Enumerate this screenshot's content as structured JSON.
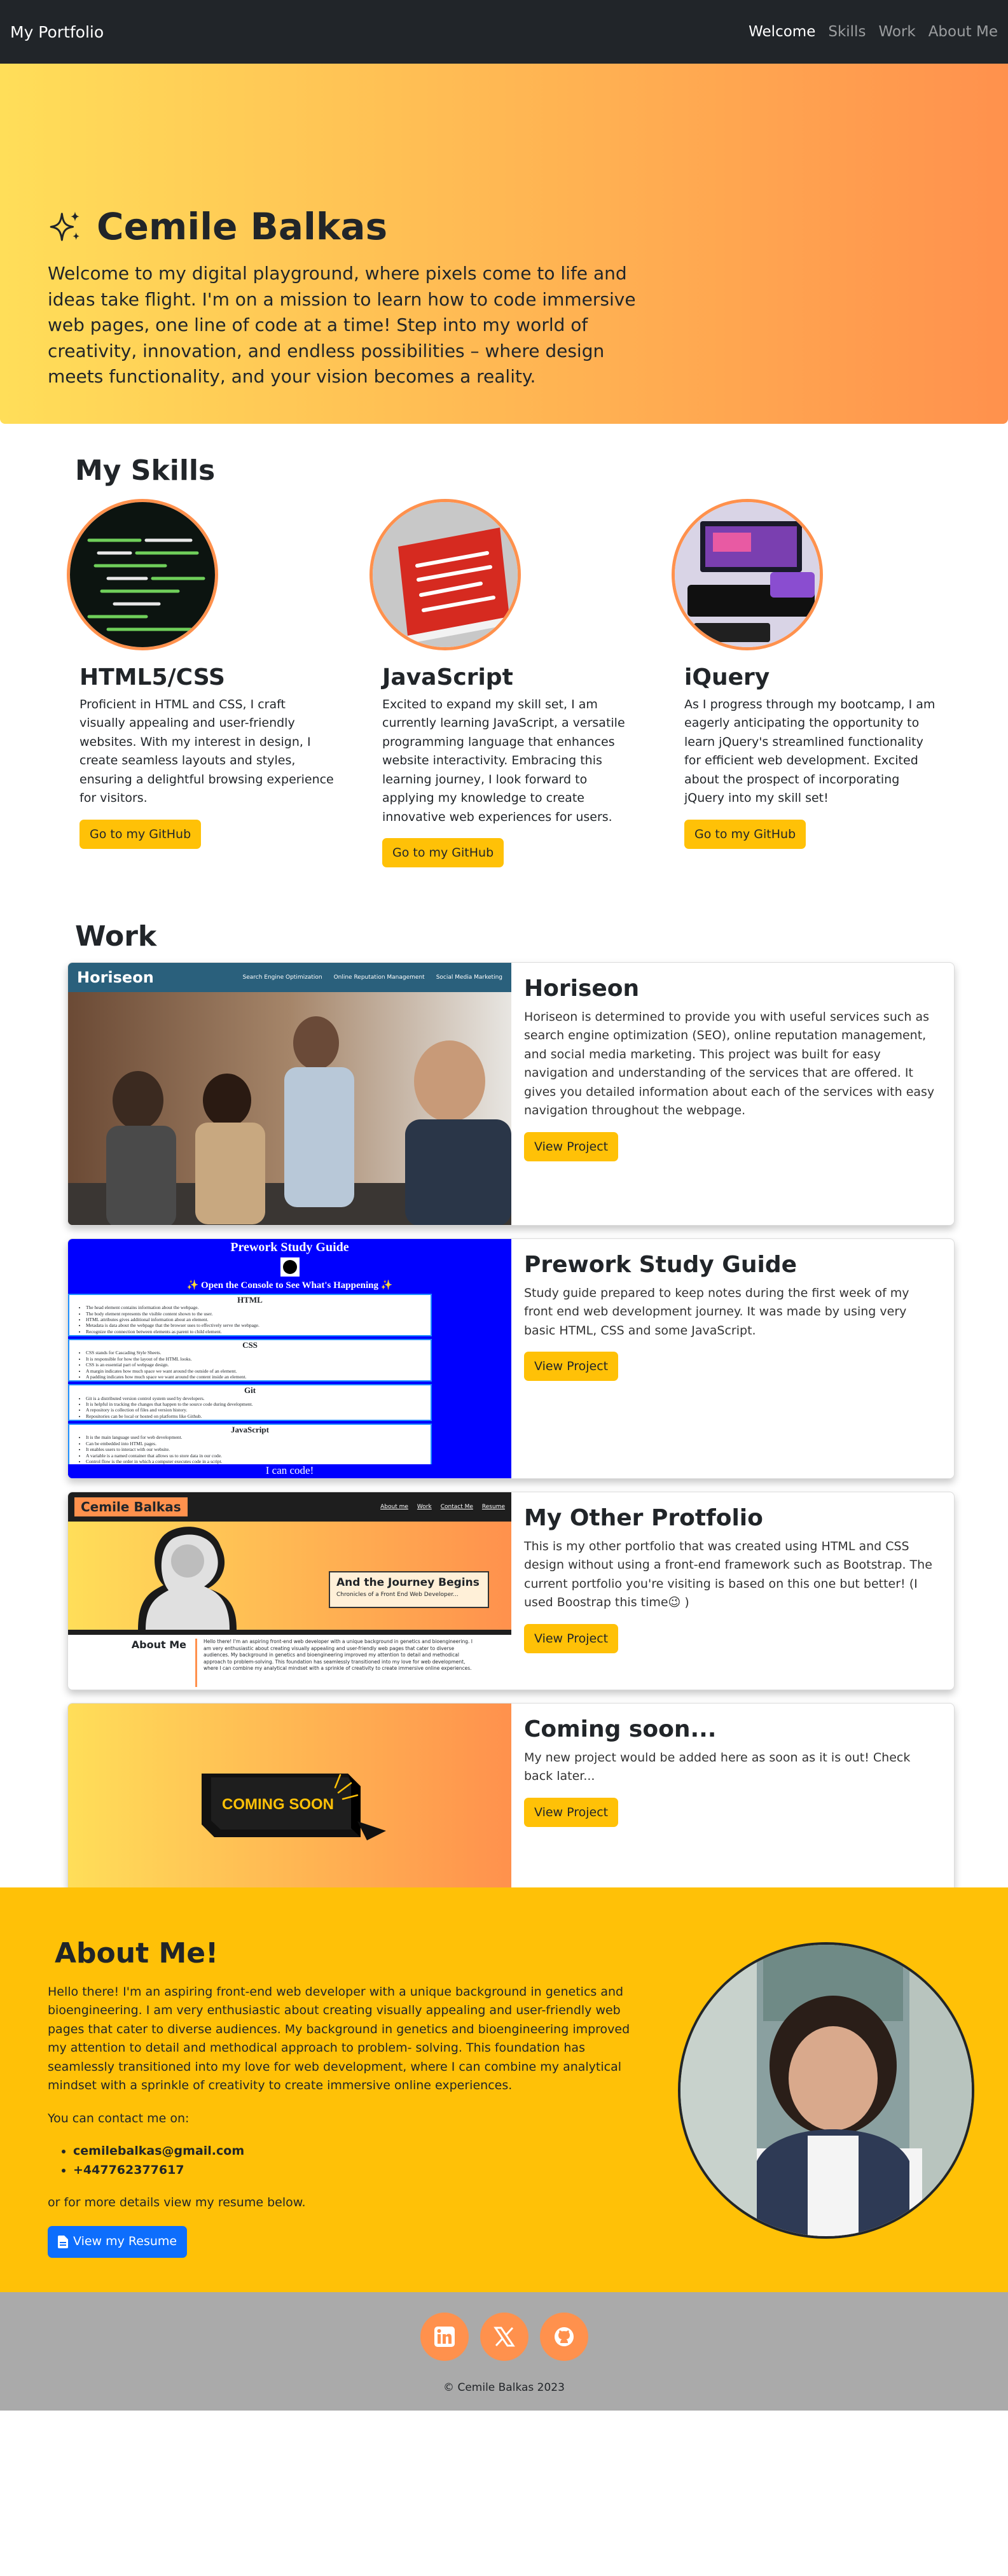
{
  "nav": {
    "brand": "My Portfolio",
    "links": [
      "Welcome",
      "Skills",
      "Work",
      "About Me"
    ]
  },
  "hero": {
    "name": "Cemile Balkas",
    "text": "Welcome to my digital playground, where pixels come to life and ideas take flight. I'm on a mission to learn how to code immersive web pages, one line of code at a time! Step into my world of creativity, innovation, and endless possibilities – where design meets functionality, and your vision becomes a reality."
  },
  "skills": {
    "title": "My Skills",
    "items": [
      {
        "title": "HTML5/CSS",
        "text": "Proficient in HTML and CSS, I craft visually appealing and user-friendly websites. With my interest in design, I create seamless layouts and styles, ensuring a delightful browsing experience for visitors.",
        "button": "Go to my GitHub"
      },
      {
        "title": "JavaScript",
        "text": "Excited to expand my skill set, I am currently learning JavaScript, a versatile programming language that enhances website interactivity. Embracing this learning journey, I look forward to applying my knowledge to create innovative web experiences for users.",
        "button": "Go to my GitHub"
      },
      {
        "title": "iQuery",
        "text": "As I progress through my bootcamp, I am eagerly anticipating the opportunity to learn jQuery's streamlined functionality for efficient web development. Excited about the prospect of incorporating jQuery into my skill set!",
        "button": "Go to my GitHub"
      }
    ]
  },
  "work": {
    "title": "Work",
    "projects": [
      {
        "title": "Horiseon",
        "text": "Horiseon is determined to provide you with useful services such as search engine optimization (SEO), online reputation management, and social media marketing. This project was built for easy navigation and understanding of the services that are offered. It gives you detailed information about each of the services with easy navigation throughout the webpage.",
        "button": "View Project",
        "preview": {
          "brand": "Horiseon",
          "nav": [
            "Search Engine Optimization",
            "Online Reputation Management",
            "Social Media Marketing"
          ]
        }
      },
      {
        "title": "Prework Study Guide",
        "text": "Study guide prepared to keep notes during the first week of my front end web development journey. It was made by using very basic HTML, CSS and some JavaScript.",
        "button": "View Project",
        "preview": {
          "heading": "Prework Study Guide",
          "console": "✨ Open the Console to See What's Happening ✨",
          "sections": [
            {
              "name": "HTML",
              "lines": [
                "The head element contains information about the webpage.",
                "The body element represents the visible content shown to the user.",
                "HTML attributes gives additional information about an element.",
                "Metadata is data about the webpage that the browser uses to effectively serve the webpage.",
                "Recognize the connection between elements as parent to child element."
              ]
            },
            {
              "name": "CSS",
              "lines": [
                "CSS stands for Cascading Style Sheets.",
                "It is responsible for how the layout of the HTML looks.",
                "CSS is an essential part of webpage design.",
                "A margin indicates how much space we want around the outside of an element.",
                "A padding indicates how much space we want around the content inside an element."
              ]
            },
            {
              "name": "Git",
              "lines": [
                "Git is a distributed version control system used by developers.",
                "It is helpful in tracking the changes that happen to the source code during development.",
                "A repository is collection of files and version history.",
                "Repositories can be local or hosted on platforms like Github."
              ]
            },
            {
              "name": "JavaScript",
              "lines": [
                "It is the main language used for web development.",
                "Can be embedded into HTML pages.",
                "It enables users to interact with our website.",
                "A variable is a named container that allows us to store data in our code.",
                "Control flow is the order in which a computer executes code in a script."
              ]
            }
          ],
          "footer": "I can code!"
        }
      },
      {
        "title": "My Other Protfolio",
        "text": "This is my other portfolio that was created using HTML and CSS design without using a front-end framework such as Bootstrap. The current portfolio you're visiting is based on this one but better! (I used Boostrap this time😉 )",
        "button": "View Project",
        "preview": {
          "brand": "Cemile Balkas",
          "nav": [
            "About me",
            "Work",
            "Contact Me",
            "Resume"
          ],
          "banner_title": "And the Journey Begins",
          "banner_sub": "Chronicles of a Front End Web Developer...",
          "about_label": "About Me",
          "about_text": "Hello there! I'm an aspiring front-end web developer with a unique background in genetics and bioengineering. I am very enthusiastic about creating visually appealing and user-friendly web pages that cater to diverse audiences. My background in genetics and bioengineering improved my attention to detail and methodical approach to problem-solving. This foundation has seamlessly transitioned into my love for web development, where I can combine my analytical mindset with a sprinkle of creativity to create immersive online experiences."
        }
      },
      {
        "title": "Coming soon...",
        "text": "My new project would be added here as soon as it is out! Check back later...",
        "button": "View Project",
        "preview": {
          "sign": "COMING SOON"
        }
      }
    ]
  },
  "about": {
    "title": "About Me!",
    "text": "Hello there! I'm an aspiring front-end web developer with a unique background in genetics and bioengineering. I am very enthusiastic about creating visually appealing and user-friendly web pages that cater to diverse audiences. My background in genetics and bioengineering improved my attention to detail and methodical approach to problem- solving. This foundation has seamlessly transitioned into my love for web development, where I can combine my analytical mindset with a sprinkle of creativity to create immersive online experiences.",
    "contact_label": "You can contact me on:",
    "contacts": [
      "cemilebalkas@gmail.com",
      "+447762377617"
    ],
    "more": "or for more details view my resume below.",
    "resume_button": "View my Resume"
  },
  "footer": {
    "icons": [
      "linkedin-icon",
      "x-icon",
      "github-icon"
    ],
    "copyright": "© Cemile Balkas 2023"
  },
  "colors": {
    "nav_bg": "#212529",
    "gradient_start": "#ffde59",
    "gradient_end": "#ff914d",
    "accent_yellow": "#ffc107",
    "accent_orange": "#ff914d",
    "button_blue": "#0d6efd",
    "footer_bg": "#aaaaaa"
  }
}
